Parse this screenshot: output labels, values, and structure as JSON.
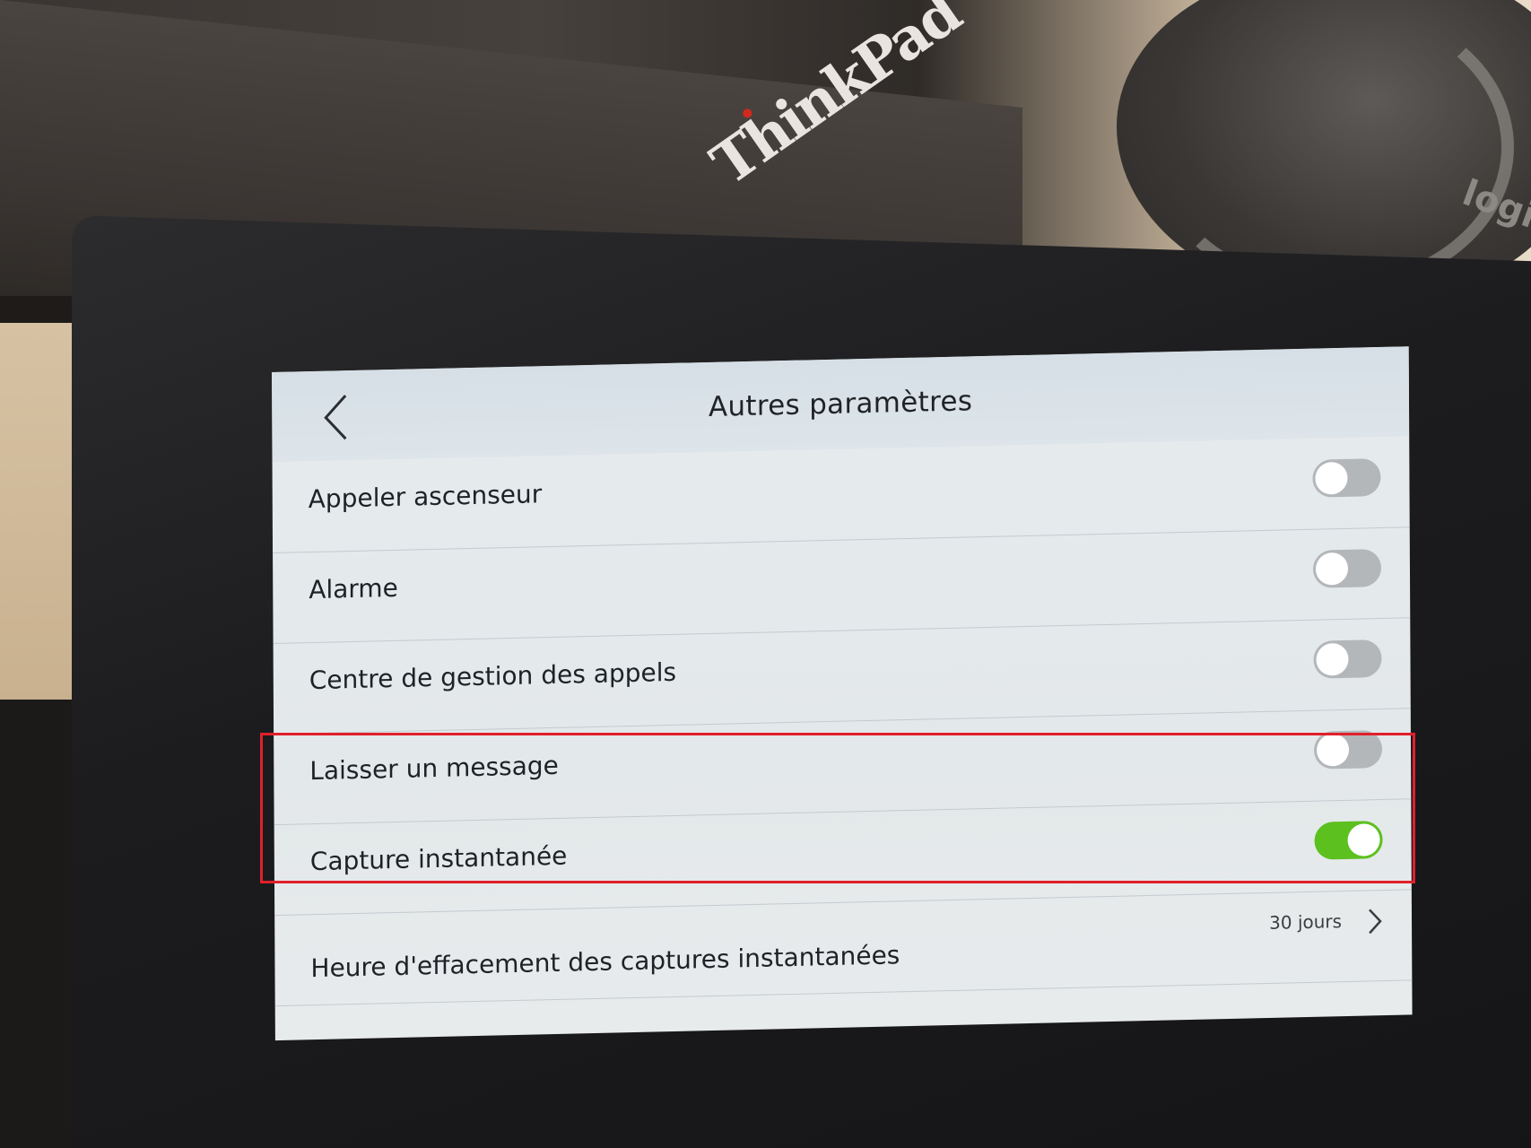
{
  "screen": {
    "title": "Autres paramètres",
    "settings": [
      {
        "label": "Appeler ascenseur",
        "enabled": false
      },
      {
        "label": "Alarme",
        "enabled": false
      },
      {
        "label": "Centre de gestion des appels",
        "enabled": false
      },
      {
        "label": "Laisser un message",
        "enabled": false
      },
      {
        "label": "Capture instantanée",
        "enabled": true
      }
    ],
    "retention": {
      "label": "Heure d'effacement des captures instantanées",
      "value": "30 jours"
    }
  },
  "background": {
    "laptop_brand": "ThinkPad",
    "mouse_brand": "logi"
  },
  "colors": {
    "toggle_on": "#5cc01e",
    "toggle_off": "#b4b7ba",
    "highlight": "#e0202a"
  },
  "icons": {
    "back": "chevron-left-icon",
    "disclosure": "chevron-right-icon"
  }
}
